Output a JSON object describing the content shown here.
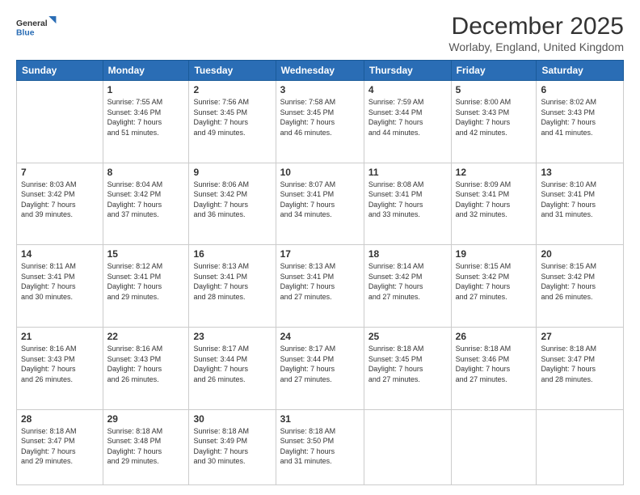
{
  "logo": {
    "line1": "General",
    "line2": "Blue"
  },
  "title": "December 2025",
  "subtitle": "Worlaby, England, United Kingdom",
  "days_header": [
    "Sunday",
    "Monday",
    "Tuesday",
    "Wednesday",
    "Thursday",
    "Friday",
    "Saturday"
  ],
  "weeks": [
    [
      {
        "num": "",
        "info": ""
      },
      {
        "num": "1",
        "info": "Sunrise: 7:55 AM\nSunset: 3:46 PM\nDaylight: 7 hours\nand 51 minutes."
      },
      {
        "num": "2",
        "info": "Sunrise: 7:56 AM\nSunset: 3:45 PM\nDaylight: 7 hours\nand 49 minutes."
      },
      {
        "num": "3",
        "info": "Sunrise: 7:58 AM\nSunset: 3:45 PM\nDaylight: 7 hours\nand 46 minutes."
      },
      {
        "num": "4",
        "info": "Sunrise: 7:59 AM\nSunset: 3:44 PM\nDaylight: 7 hours\nand 44 minutes."
      },
      {
        "num": "5",
        "info": "Sunrise: 8:00 AM\nSunset: 3:43 PM\nDaylight: 7 hours\nand 42 minutes."
      },
      {
        "num": "6",
        "info": "Sunrise: 8:02 AM\nSunset: 3:43 PM\nDaylight: 7 hours\nand 41 minutes."
      }
    ],
    [
      {
        "num": "7",
        "info": "Sunrise: 8:03 AM\nSunset: 3:42 PM\nDaylight: 7 hours\nand 39 minutes."
      },
      {
        "num": "8",
        "info": "Sunrise: 8:04 AM\nSunset: 3:42 PM\nDaylight: 7 hours\nand 37 minutes."
      },
      {
        "num": "9",
        "info": "Sunrise: 8:06 AM\nSunset: 3:42 PM\nDaylight: 7 hours\nand 36 minutes."
      },
      {
        "num": "10",
        "info": "Sunrise: 8:07 AM\nSunset: 3:41 PM\nDaylight: 7 hours\nand 34 minutes."
      },
      {
        "num": "11",
        "info": "Sunrise: 8:08 AM\nSunset: 3:41 PM\nDaylight: 7 hours\nand 33 minutes."
      },
      {
        "num": "12",
        "info": "Sunrise: 8:09 AM\nSunset: 3:41 PM\nDaylight: 7 hours\nand 32 minutes."
      },
      {
        "num": "13",
        "info": "Sunrise: 8:10 AM\nSunset: 3:41 PM\nDaylight: 7 hours\nand 31 minutes."
      }
    ],
    [
      {
        "num": "14",
        "info": "Sunrise: 8:11 AM\nSunset: 3:41 PM\nDaylight: 7 hours\nand 30 minutes."
      },
      {
        "num": "15",
        "info": "Sunrise: 8:12 AM\nSunset: 3:41 PM\nDaylight: 7 hours\nand 29 minutes."
      },
      {
        "num": "16",
        "info": "Sunrise: 8:13 AM\nSunset: 3:41 PM\nDaylight: 7 hours\nand 28 minutes."
      },
      {
        "num": "17",
        "info": "Sunrise: 8:13 AM\nSunset: 3:41 PM\nDaylight: 7 hours\nand 27 minutes."
      },
      {
        "num": "18",
        "info": "Sunrise: 8:14 AM\nSunset: 3:42 PM\nDaylight: 7 hours\nand 27 minutes."
      },
      {
        "num": "19",
        "info": "Sunrise: 8:15 AM\nSunset: 3:42 PM\nDaylight: 7 hours\nand 27 minutes."
      },
      {
        "num": "20",
        "info": "Sunrise: 8:15 AM\nSunset: 3:42 PM\nDaylight: 7 hours\nand 26 minutes."
      }
    ],
    [
      {
        "num": "21",
        "info": "Sunrise: 8:16 AM\nSunset: 3:43 PM\nDaylight: 7 hours\nand 26 minutes."
      },
      {
        "num": "22",
        "info": "Sunrise: 8:16 AM\nSunset: 3:43 PM\nDaylight: 7 hours\nand 26 minutes."
      },
      {
        "num": "23",
        "info": "Sunrise: 8:17 AM\nSunset: 3:44 PM\nDaylight: 7 hours\nand 26 minutes."
      },
      {
        "num": "24",
        "info": "Sunrise: 8:17 AM\nSunset: 3:44 PM\nDaylight: 7 hours\nand 27 minutes."
      },
      {
        "num": "25",
        "info": "Sunrise: 8:18 AM\nSunset: 3:45 PM\nDaylight: 7 hours\nand 27 minutes."
      },
      {
        "num": "26",
        "info": "Sunrise: 8:18 AM\nSunset: 3:46 PM\nDaylight: 7 hours\nand 27 minutes."
      },
      {
        "num": "27",
        "info": "Sunrise: 8:18 AM\nSunset: 3:47 PM\nDaylight: 7 hours\nand 28 minutes."
      }
    ],
    [
      {
        "num": "28",
        "info": "Sunrise: 8:18 AM\nSunset: 3:47 PM\nDaylight: 7 hours\nand 29 minutes."
      },
      {
        "num": "29",
        "info": "Sunrise: 8:18 AM\nSunset: 3:48 PM\nDaylight: 7 hours\nand 29 minutes."
      },
      {
        "num": "30",
        "info": "Sunrise: 8:18 AM\nSunset: 3:49 PM\nDaylight: 7 hours\nand 30 minutes."
      },
      {
        "num": "31",
        "info": "Sunrise: 8:18 AM\nSunset: 3:50 PM\nDaylight: 7 hours\nand 31 minutes."
      },
      {
        "num": "",
        "info": ""
      },
      {
        "num": "",
        "info": ""
      },
      {
        "num": "",
        "info": ""
      }
    ]
  ]
}
